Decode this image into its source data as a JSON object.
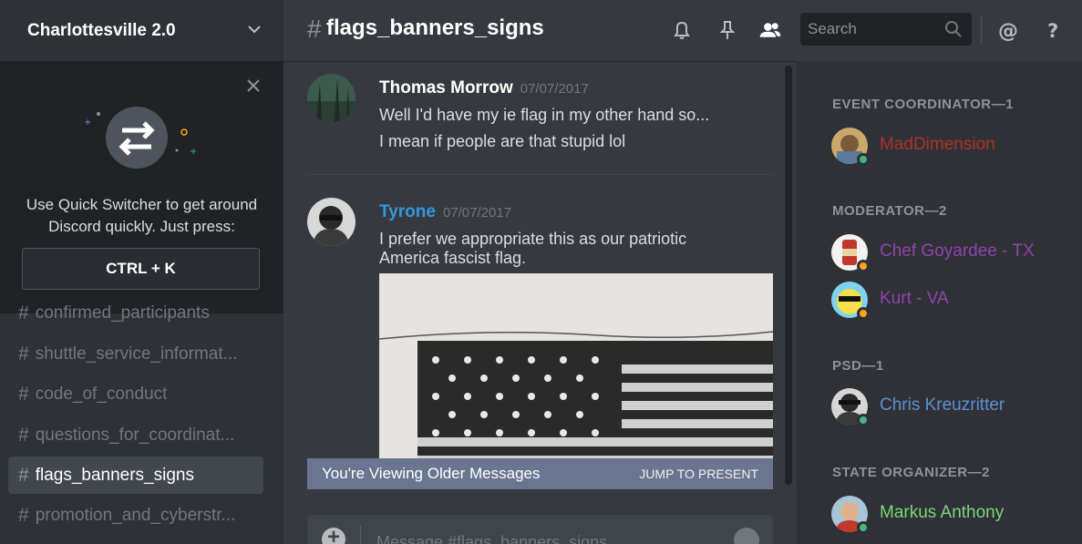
{
  "server": {
    "name": "Charlottesville 2.0"
  },
  "quick_switcher": {
    "text": "Use Quick Switcher to get around Discord quickly. Just press:",
    "shortcut": "CTRL + K"
  },
  "channels": [
    {
      "name": "confirmed_participants",
      "active": false
    },
    {
      "name": "shuttle_service_informat...",
      "active": false
    },
    {
      "name": "code_of_conduct",
      "active": false
    },
    {
      "name": "questions_for_coordinat...",
      "active": false
    },
    {
      "name": "flags_banners_signs",
      "active": true
    },
    {
      "name": "promotion_and_cyberstr...",
      "active": false
    }
  ],
  "header": {
    "hash": "#",
    "channel_name": "flags_banners_signs",
    "search_placeholder": "Search"
  },
  "messages": [
    {
      "author": "Thomas Morrow",
      "author_color": "#ffffff",
      "timestamp": "07/07/2017",
      "lines": [
        "Well I'd have my ie flag in my other hand so...",
        "I mean if people are that stupid lol"
      ]
    },
    {
      "author": "Tyrone",
      "author_color": "#3498db",
      "timestamp": "07/07/2017",
      "lines": [
        "I prefer we appropriate this as our patriotic",
        "America fascist flag."
      ],
      "attachment": "flag-image"
    }
  ],
  "older_bar": {
    "text": "You're Viewing Older Messages",
    "jump": "JUMP TO PRESENT"
  },
  "composer": {
    "placeholder": "Message #flags_banners_signs"
  },
  "member_groups": [
    {
      "role": "EVENT COORDINATOR—1",
      "members": [
        {
          "name": "MadDimension",
          "color": "#a93226",
          "status": "online"
        }
      ]
    },
    {
      "role": "MODERATOR—2",
      "members": [
        {
          "name": "Chef Goyardee - TX",
          "color": "#8e44ad",
          "status": "idle"
        },
        {
          "name": "Kurt - VA",
          "color": "#8e44ad",
          "status": "idle"
        }
      ]
    },
    {
      "role": "PSD—1",
      "members": [
        {
          "name": "Chris Kreuzritter",
          "color": "#5c8fd6",
          "status": "online"
        }
      ]
    },
    {
      "role": "STATE ORGANIZER—2",
      "members": [
        {
          "name": "Markus Anthony",
          "color": "#7bd67b",
          "status": "online"
        }
      ]
    }
  ],
  "status_colors": {
    "online": "#43b581",
    "idle": "#faa61a"
  }
}
